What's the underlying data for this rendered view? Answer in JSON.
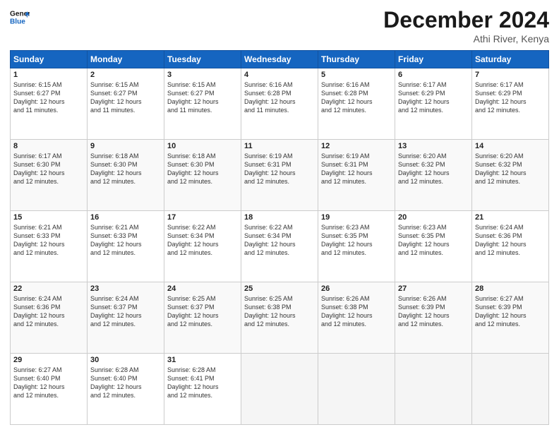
{
  "header": {
    "logo_line1": "General",
    "logo_line2": "Blue",
    "month": "December 2024",
    "location": "Athi River, Kenya"
  },
  "weekdays": [
    "Sunday",
    "Monday",
    "Tuesday",
    "Wednesday",
    "Thursday",
    "Friday",
    "Saturday"
  ],
  "weeks": [
    [
      {
        "day": "1",
        "sunrise": "6:15 AM",
        "sunset": "6:27 PM",
        "daylight": "12 hours and 11 minutes."
      },
      {
        "day": "2",
        "sunrise": "6:15 AM",
        "sunset": "6:27 PM",
        "daylight": "12 hours and 11 minutes."
      },
      {
        "day": "3",
        "sunrise": "6:15 AM",
        "sunset": "6:27 PM",
        "daylight": "12 hours and 11 minutes."
      },
      {
        "day": "4",
        "sunrise": "6:16 AM",
        "sunset": "6:28 PM",
        "daylight": "12 hours and 11 minutes."
      },
      {
        "day": "5",
        "sunrise": "6:16 AM",
        "sunset": "6:28 PM",
        "daylight": "12 hours and 12 minutes."
      },
      {
        "day": "6",
        "sunrise": "6:17 AM",
        "sunset": "6:29 PM",
        "daylight": "12 hours and 12 minutes."
      },
      {
        "day": "7",
        "sunrise": "6:17 AM",
        "sunset": "6:29 PM",
        "daylight": "12 hours and 12 minutes."
      }
    ],
    [
      {
        "day": "8",
        "sunrise": "6:17 AM",
        "sunset": "6:30 PM",
        "daylight": "12 hours and 12 minutes."
      },
      {
        "day": "9",
        "sunrise": "6:18 AM",
        "sunset": "6:30 PM",
        "daylight": "12 hours and 12 minutes."
      },
      {
        "day": "10",
        "sunrise": "6:18 AM",
        "sunset": "6:30 PM",
        "daylight": "12 hours and 12 minutes."
      },
      {
        "day": "11",
        "sunrise": "6:19 AM",
        "sunset": "6:31 PM",
        "daylight": "12 hours and 12 minutes."
      },
      {
        "day": "12",
        "sunrise": "6:19 AM",
        "sunset": "6:31 PM",
        "daylight": "12 hours and 12 minutes."
      },
      {
        "day": "13",
        "sunrise": "6:20 AM",
        "sunset": "6:32 PM",
        "daylight": "12 hours and 12 minutes."
      },
      {
        "day": "14",
        "sunrise": "6:20 AM",
        "sunset": "6:32 PM",
        "daylight": "12 hours and 12 minutes."
      }
    ],
    [
      {
        "day": "15",
        "sunrise": "6:21 AM",
        "sunset": "6:33 PM",
        "daylight": "12 hours and 12 minutes."
      },
      {
        "day": "16",
        "sunrise": "6:21 AM",
        "sunset": "6:33 PM",
        "daylight": "12 hours and 12 minutes."
      },
      {
        "day": "17",
        "sunrise": "6:22 AM",
        "sunset": "6:34 PM",
        "daylight": "12 hours and 12 minutes."
      },
      {
        "day": "18",
        "sunrise": "6:22 AM",
        "sunset": "6:34 PM",
        "daylight": "12 hours and 12 minutes."
      },
      {
        "day": "19",
        "sunrise": "6:23 AM",
        "sunset": "6:35 PM",
        "daylight": "12 hours and 12 minutes."
      },
      {
        "day": "20",
        "sunrise": "6:23 AM",
        "sunset": "6:35 PM",
        "daylight": "12 hours and 12 minutes."
      },
      {
        "day": "21",
        "sunrise": "6:24 AM",
        "sunset": "6:36 PM",
        "daylight": "12 hours and 12 minutes."
      }
    ],
    [
      {
        "day": "22",
        "sunrise": "6:24 AM",
        "sunset": "6:36 PM",
        "daylight": "12 hours and 12 minutes."
      },
      {
        "day": "23",
        "sunrise": "6:24 AM",
        "sunset": "6:37 PM",
        "daylight": "12 hours and 12 minutes."
      },
      {
        "day": "24",
        "sunrise": "6:25 AM",
        "sunset": "6:37 PM",
        "daylight": "12 hours and 12 minutes."
      },
      {
        "day": "25",
        "sunrise": "6:25 AM",
        "sunset": "6:38 PM",
        "daylight": "12 hours and 12 minutes."
      },
      {
        "day": "26",
        "sunrise": "6:26 AM",
        "sunset": "6:38 PM",
        "daylight": "12 hours and 12 minutes."
      },
      {
        "day": "27",
        "sunrise": "6:26 AM",
        "sunset": "6:39 PM",
        "daylight": "12 hours and 12 minutes."
      },
      {
        "day": "28",
        "sunrise": "6:27 AM",
        "sunset": "6:39 PM",
        "daylight": "12 hours and 12 minutes."
      }
    ],
    [
      {
        "day": "29",
        "sunrise": "6:27 AM",
        "sunset": "6:40 PM",
        "daylight": "12 hours and 12 minutes."
      },
      {
        "day": "30",
        "sunrise": "6:28 AM",
        "sunset": "6:40 PM",
        "daylight": "12 hours and 12 minutes."
      },
      {
        "day": "31",
        "sunrise": "6:28 AM",
        "sunset": "6:41 PM",
        "daylight": "12 hours and 12 minutes."
      },
      null,
      null,
      null,
      null
    ]
  ],
  "labels": {
    "sunrise": "Sunrise: ",
    "sunset": "Sunset: ",
    "daylight": "Daylight: "
  }
}
